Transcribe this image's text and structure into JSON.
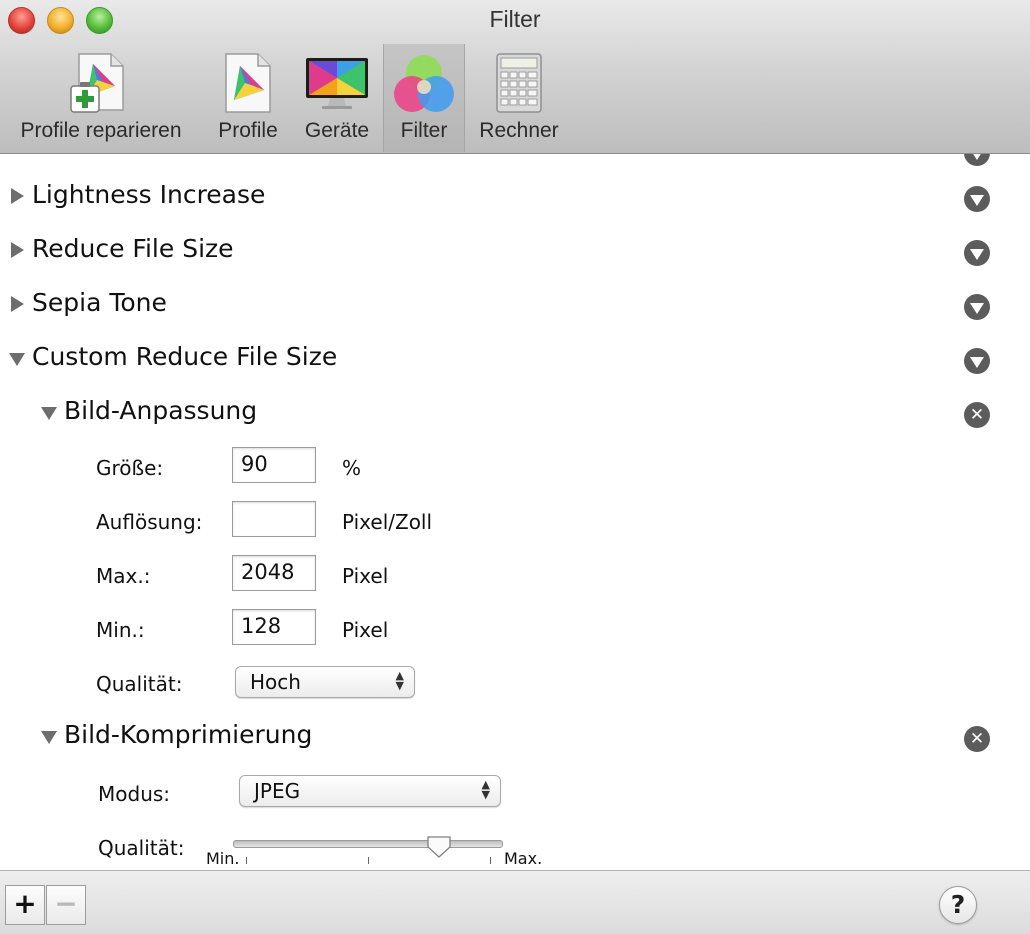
{
  "window": {
    "title": "Filter"
  },
  "toolbar": {
    "items": [
      {
        "label": "Profile reparieren",
        "icon": "profile-repair-icon"
      },
      {
        "label": "Profile",
        "icon": "color-profile-icon"
      },
      {
        "label": "Geräte",
        "icon": "display-device-icon"
      },
      {
        "label": "Filter",
        "icon": "color-filter-icon",
        "selected": true
      },
      {
        "label": "Rechner",
        "icon": "calculator-icon"
      }
    ]
  },
  "filters": [
    {
      "name": "Lightness Increase",
      "expanded": false
    },
    {
      "name": "Reduce File Size",
      "expanded": false
    },
    {
      "name": "Sepia Tone",
      "expanded": false
    },
    {
      "name": "Custom Reduce File Size",
      "expanded": true
    }
  ],
  "image_adjustment": {
    "title": "Bild-Anpassung",
    "size_label": "Größe:",
    "size_value": "90",
    "size_unit": "%",
    "resolution_label": "Auflösung:",
    "resolution_value": "",
    "resolution_unit": "Pixel/Zoll",
    "max_label": "Max.:",
    "max_value": "2048",
    "max_unit": "Pixel",
    "min_label": "Min.:",
    "min_value": "128",
    "min_unit": "Pixel",
    "quality_label": "Qualität:",
    "quality_value": "Hoch"
  },
  "image_compression": {
    "title": "Bild-Komprimierung",
    "mode_label": "Modus:",
    "mode_value": "JPEG",
    "quality_label": "Qualität:",
    "slider_min_label": "Min.",
    "slider_max_label": "Max.",
    "quality_fraction": 0.79
  },
  "bottom_bar": {
    "add_label": "+",
    "remove_label": "−",
    "help_label": "?"
  },
  "colors": {
    "circle_button": "#5c5c5c",
    "disclosure": "#6d6d6d"
  }
}
